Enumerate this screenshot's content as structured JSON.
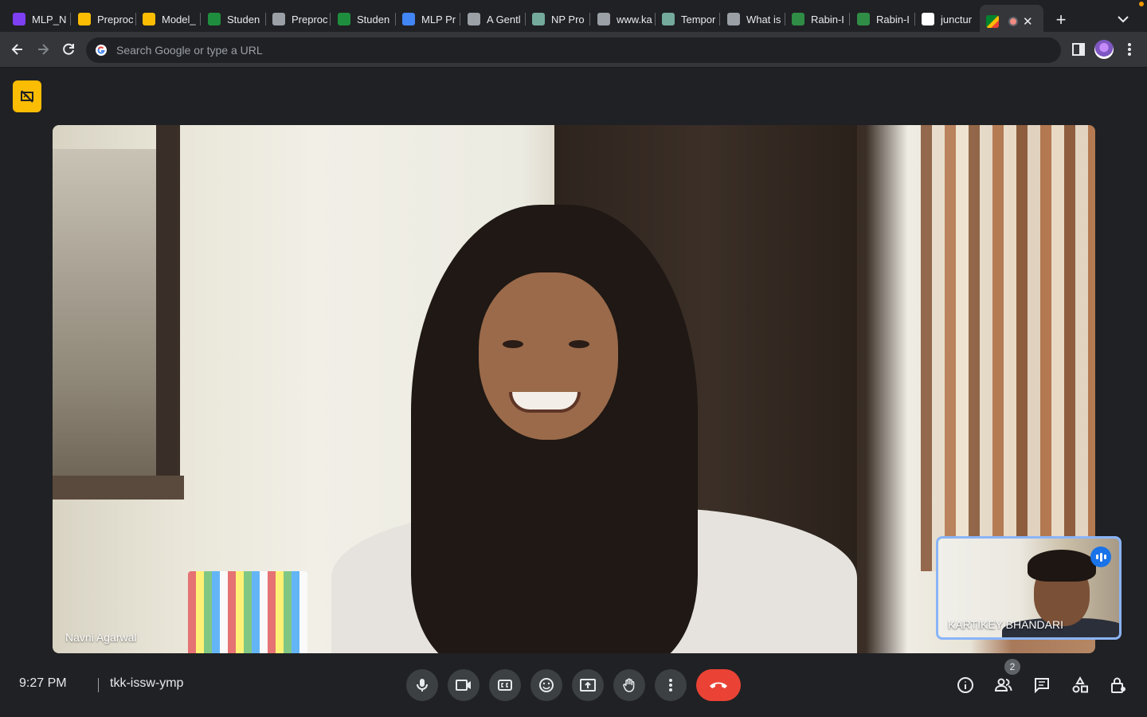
{
  "browser": {
    "tabs": [
      {
        "title": "MLP_N",
        "icon": "forms-icon",
        "color": "#7e3ff2"
      },
      {
        "title": "Preproc",
        "icon": "google-drive-icon",
        "color": "#fbbc04"
      },
      {
        "title": "Model_",
        "icon": "google-drive-icon",
        "color": "#fbbc04"
      },
      {
        "title": "Studen",
        "icon": "globe-icon",
        "color": "#1e8e3e"
      },
      {
        "title": "Preproc",
        "icon": "colab-icon",
        "color": "#9aa0a6"
      },
      {
        "title": "Studen",
        "icon": "globe-icon",
        "color": "#1e8e3e"
      },
      {
        "title": "MLP Pr",
        "icon": "docs-icon",
        "color": "#4285f4"
      },
      {
        "title": "A Gentl",
        "icon": "globe-icon",
        "color": "#9aa0a6"
      },
      {
        "title": "NP Pro",
        "icon": "chatgpt-icon",
        "color": "#74aa9c"
      },
      {
        "title": "www.ka",
        "icon": "kaggle-icon",
        "color": "#9aa0a6"
      },
      {
        "title": "Tempor",
        "icon": "chatgpt-icon",
        "color": "#74aa9c"
      },
      {
        "title": "What is",
        "icon": "network-icon",
        "color": "#9aa0a6"
      },
      {
        "title": "Rabin-I",
        "icon": "gfg-icon",
        "color": "#2f8d46"
      },
      {
        "title": "Rabin-I",
        "icon": "gfg-icon",
        "color": "#2f8d46"
      },
      {
        "title": "junctur",
        "icon": "google-icon",
        "color": "#ffffff"
      }
    ],
    "active_tab": {
      "title": "",
      "icon": "meet-icon",
      "recording": true
    },
    "new_tab_label": "+",
    "omnibox_placeholder": "Search Google or type a URL"
  },
  "meet": {
    "main_participant": "Navni Agarwal",
    "self_participant": "KARTIKEY BHANDARI",
    "time": "9:27 PM",
    "meeting_code": "tkk-issw-ymp",
    "participant_count": "2",
    "accent": "#8ab4f8",
    "hangup_color": "#ea4335",
    "warning_color": "#fbbc04"
  }
}
